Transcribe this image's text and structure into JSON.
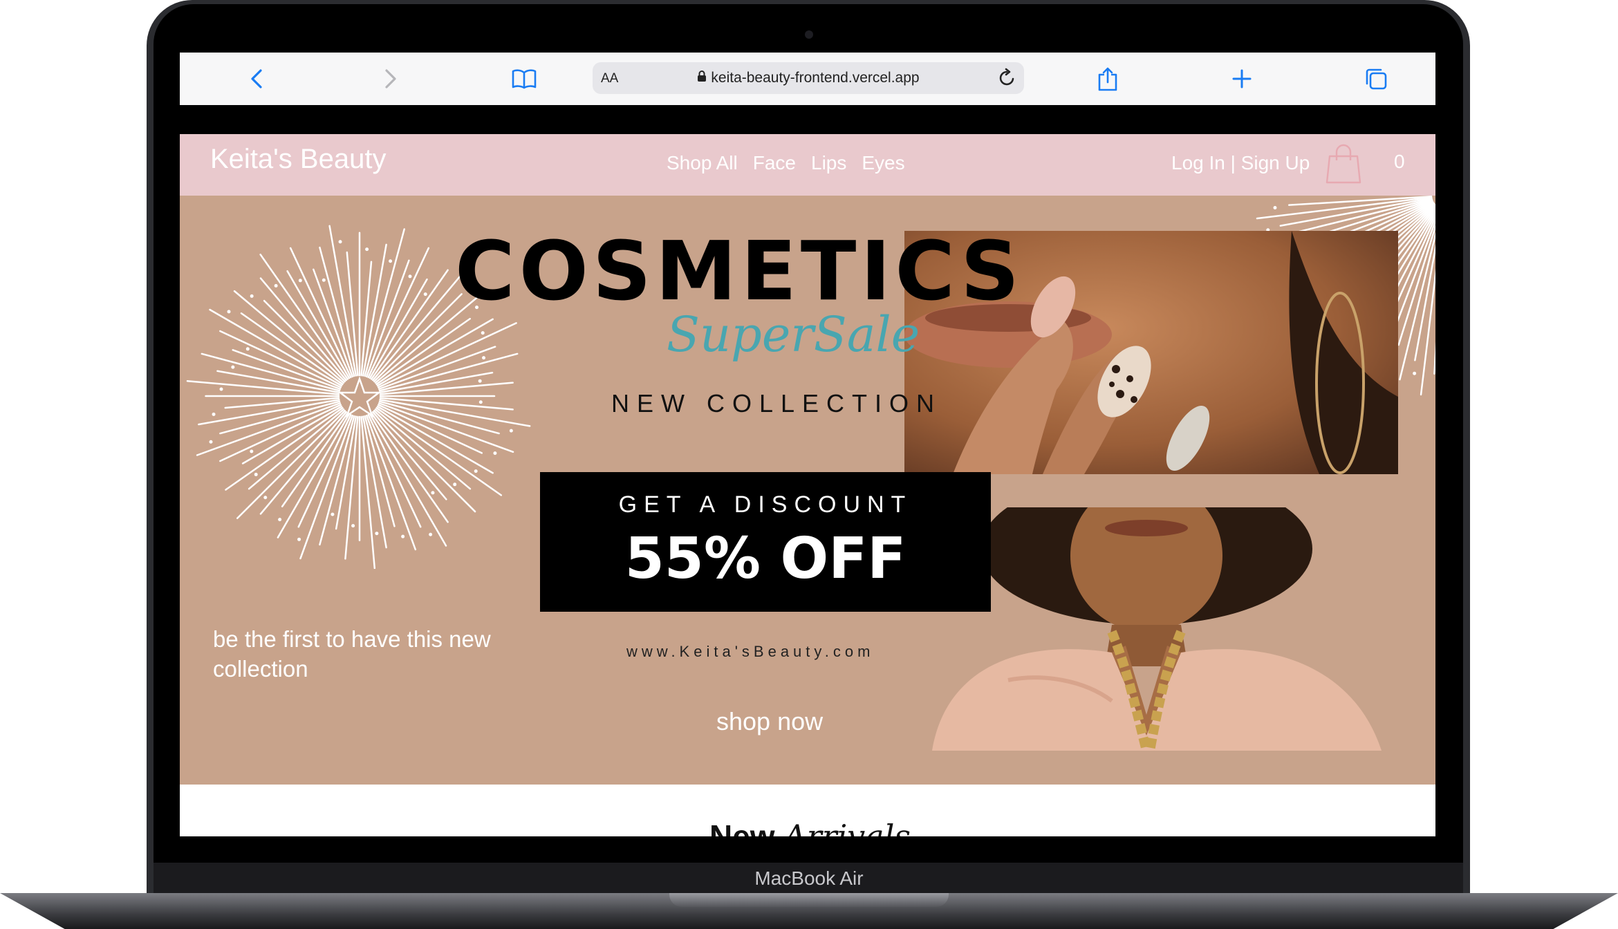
{
  "device": {
    "model_label": "MacBook Air"
  },
  "browser": {
    "text_size_label": "AA",
    "url": "keita-beauty-frontend.vercel.app",
    "icons": [
      "chevron-left-icon",
      "chevron-right-icon",
      "book-icon",
      "lock-icon",
      "reload-icon",
      "share-icon",
      "plus-icon",
      "tabs-icon"
    ]
  },
  "site": {
    "brand": "Keita's Beauty",
    "nav": [
      "Shop All",
      "Face",
      "Lips",
      "Eyes"
    ],
    "auth": "Log In | Sign Up",
    "cart_count": "0"
  },
  "hero": {
    "title": "COSMETICS",
    "script": "SuperSale",
    "subtitle": "NEW COLLECTION",
    "discount_label": "GET A DISCOUNT",
    "discount_value": "55% OFF",
    "tagline": "be the first to have this new collection",
    "website": "www.Keita'sBeauty.com",
    "cta": "shop now"
  },
  "section": {
    "title_bold": "New",
    "title_italic": "Arrivals"
  },
  "colors": {
    "nav_bg": "#e9c9cd",
    "hero_bg": "#c8a38b",
    "accent_teal": "#49a6b0",
    "bag_icon": "#e7a9b1"
  }
}
